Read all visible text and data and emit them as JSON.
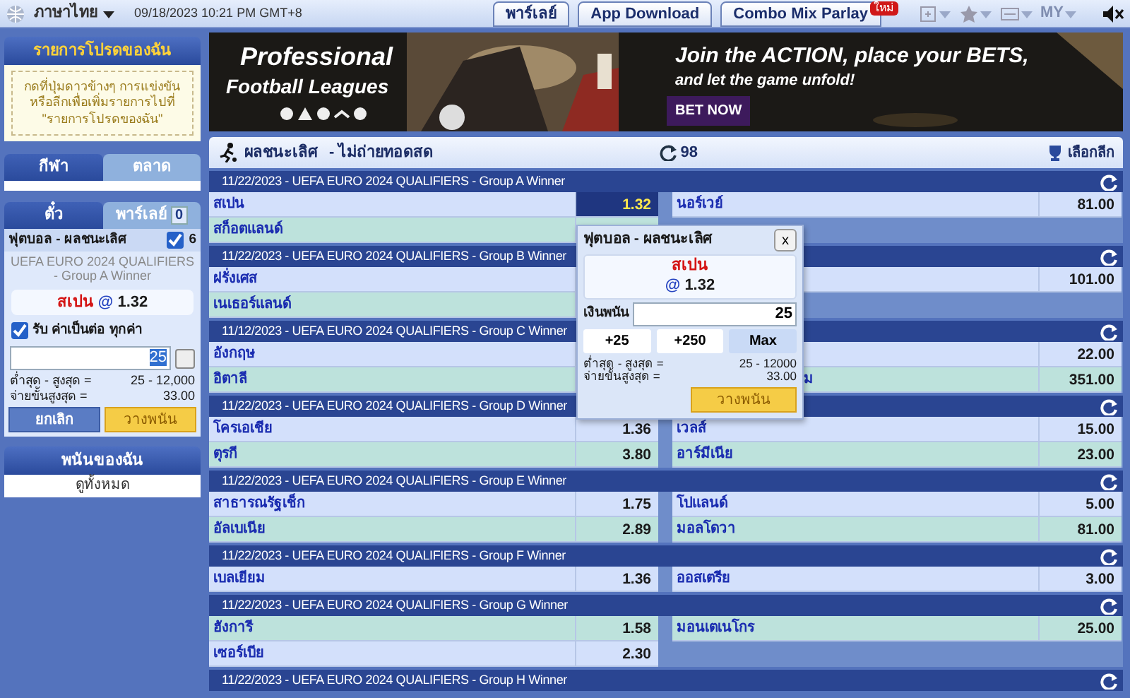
{
  "top_bar": {
    "language": "ภาษาไทย",
    "datetime": "09/18/2023 10:21 PM GMT+8",
    "buttons": [
      {
        "label": "พาร์เลย์"
      },
      {
        "label": "App Download"
      },
      {
        "label": "Combo Mix Parlay",
        "badge": "ใหม่"
      }
    ],
    "account": {
      "label": "MY",
      "disabled": true
    }
  },
  "sidebar": {
    "favorites": {
      "title": "รายการโปรดของฉัน",
      "hint": "กดที่ปุ่มดาวข้างๆ การแข่งขัน หรือลีกเพื่อเพิ่มรายการไปที่ \"รายการโปรดของฉัน\""
    },
    "menu_tabs": [
      {
        "label": "กีฬา",
        "selected": true
      },
      {
        "label": "ตลาด",
        "selected": false
      }
    ],
    "slip_tabs": [
      {
        "label": "ตั๋ว",
        "selected": true
      },
      {
        "label": "พาร์เลย์",
        "count": "0",
        "selected": false
      }
    ],
    "slip": {
      "market": "ฟุตบอล - ผลชนะเลิศ",
      "checked": true,
      "count": "6",
      "league": "UEFA EURO 2024 QUALIFIERS - Group A Winner",
      "selection": "สเปน",
      "at": "@",
      "odds": "1.32",
      "accept_label": "รับ ค่าเป็นต่อ ทุกค่า",
      "accept_checked": true,
      "stake": "25",
      "quick_checked": false,
      "limits": [
        {
          "label": "ต่ำสุด - สูงสุด =",
          "value": "25 - 12,000"
        },
        {
          "label": "จ่ายขั้นสูงสุด =",
          "value": "33.00"
        }
      ],
      "cancel": "ยกเลิก",
      "place": "วางพนัน"
    },
    "my_bets": {
      "title": "พนันของฉัน",
      "link": "ดูทั้งหมด"
    }
  },
  "banner": {
    "title": "Professional",
    "subtitle": "Football Leagues",
    "headline": "Join the ACTION, place your BETS,",
    "tagline": "and let the game unfold!",
    "button": "BET NOW"
  },
  "market_header": {
    "title": "ผลชนะเลิศ",
    "subtitle": "- ไม่ถ่ายทอดสด",
    "count": "98",
    "league_button": "เลือกลีก"
  },
  "groups": [
    {
      "title": "11/22/2023 - UEFA EURO 2024 QUALIFIERS - Group A Winner",
      "rows": [
        {
          "left": {
            "team": "สเปน",
            "odds": "1.32",
            "selected": true
          },
          "right": {
            "team": "นอร์เวย์",
            "odds": "81.00",
            "selected": false
          }
        },
        {
          "left": {
            "team": "สก็อตแลนด์"
          },
          "right": null
        }
      ]
    },
    {
      "title": "11/22/2023 - UEFA EURO 2024 QUALIFIERS - Group B Winner",
      "rows": [
        {
          "left": {
            "team": "ฝรั่งเศส"
          },
          "right": {
            "odds": "101.00",
            "selected": false
          }
        },
        {
          "left": {
            "team": "เนเธอร์แลนด์"
          },
          "right": null
        }
      ]
    },
    {
      "title": "11/12/2023 - UEFA EURO 2024 QUALIFIERS - Group C Winner",
      "rows": [
        {
          "left": {
            "team": "อังกฤษ"
          },
          "right": {
            "odds": "22.00",
            "selected": false
          }
        },
        {
          "left": {
            "team": "อิตาลี"
          },
          "right": {
            "team": "ม",
            "odds": "351.00",
            "selected": false,
            "clipped": true
          }
        }
      ]
    },
    {
      "title": "11/22/2023 - UEFA EURO 2024 QUALIFIERS - Group D Winner",
      "rows": [
        {
          "left": {
            "team": "โครเอเชีย",
            "odds": "1.36",
            "selected": false
          },
          "right": {
            "team": "เวลส์",
            "odds": "15.00",
            "selected": false
          }
        },
        {
          "left": {
            "team": "ตุรกี",
            "odds": "3.80",
            "selected": false
          },
          "right": {
            "team": "อาร์มีเนีย",
            "odds": "23.00",
            "selected": false
          }
        }
      ]
    },
    {
      "title": "11/22/2023 - UEFA EURO 2024 QUALIFIERS - Group E Winner",
      "rows": [
        {
          "left": {
            "team": "สาธารณรัฐเช็ก",
            "odds": "1.75",
            "selected": false
          },
          "right": {
            "team": "โปแลนด์",
            "odds": "5.00",
            "selected": false
          }
        },
        {
          "left": {
            "team": "อัลเบเนีย",
            "odds": "2.89",
            "selected": false
          },
          "right": {
            "team": "มอลโดวา",
            "odds": "81.00",
            "selected": false
          }
        }
      ]
    },
    {
      "title": "11/22/2023 - UEFA EURO 2024 QUALIFIERS - Group F Winner",
      "rows": [
        {
          "left": {
            "team": "เบลเยียม",
            "odds": "1.36",
            "selected": false
          },
          "right": {
            "team": "ออสเตรีย",
            "odds": "3.00",
            "selected": false
          }
        }
      ]
    },
    {
      "title": "11/22/2023 - UEFA EURO 2024 QUALIFIERS - Group G Winner",
      "rows": [
        {
          "left": {
            "team": "ฮังการี",
            "odds": "1.58",
            "selected": false
          },
          "right": {
            "team": "มอนเตเนโกร",
            "odds": "25.00",
            "selected": false
          }
        },
        {
          "left": {
            "team": "เซอร์เบีย",
            "odds": "2.30",
            "selected": false
          },
          "right": null
        }
      ]
    },
    {
      "title": "11/22/2023 - UEFA EURO 2024 QUALIFIERS - Group H Winner"
    }
  ],
  "bet_popup": {
    "title": "ฟุตบอล - ผลชนะเลิศ",
    "close": "x",
    "selection": "สเปน",
    "at": "@",
    "odds": "1.32",
    "stake_label": "เงินพนัน",
    "stake": "25",
    "quick": [
      "+25",
      "+250",
      "Max"
    ],
    "limits": [
      {
        "label": "ต่ำสุด - สูงสุด =",
        "value": "25 - 12000"
      },
      {
        "label": "จ่ายขั้นสูงสุด =",
        "value": "33.00"
      }
    ],
    "place": "วางพนัน"
  }
}
